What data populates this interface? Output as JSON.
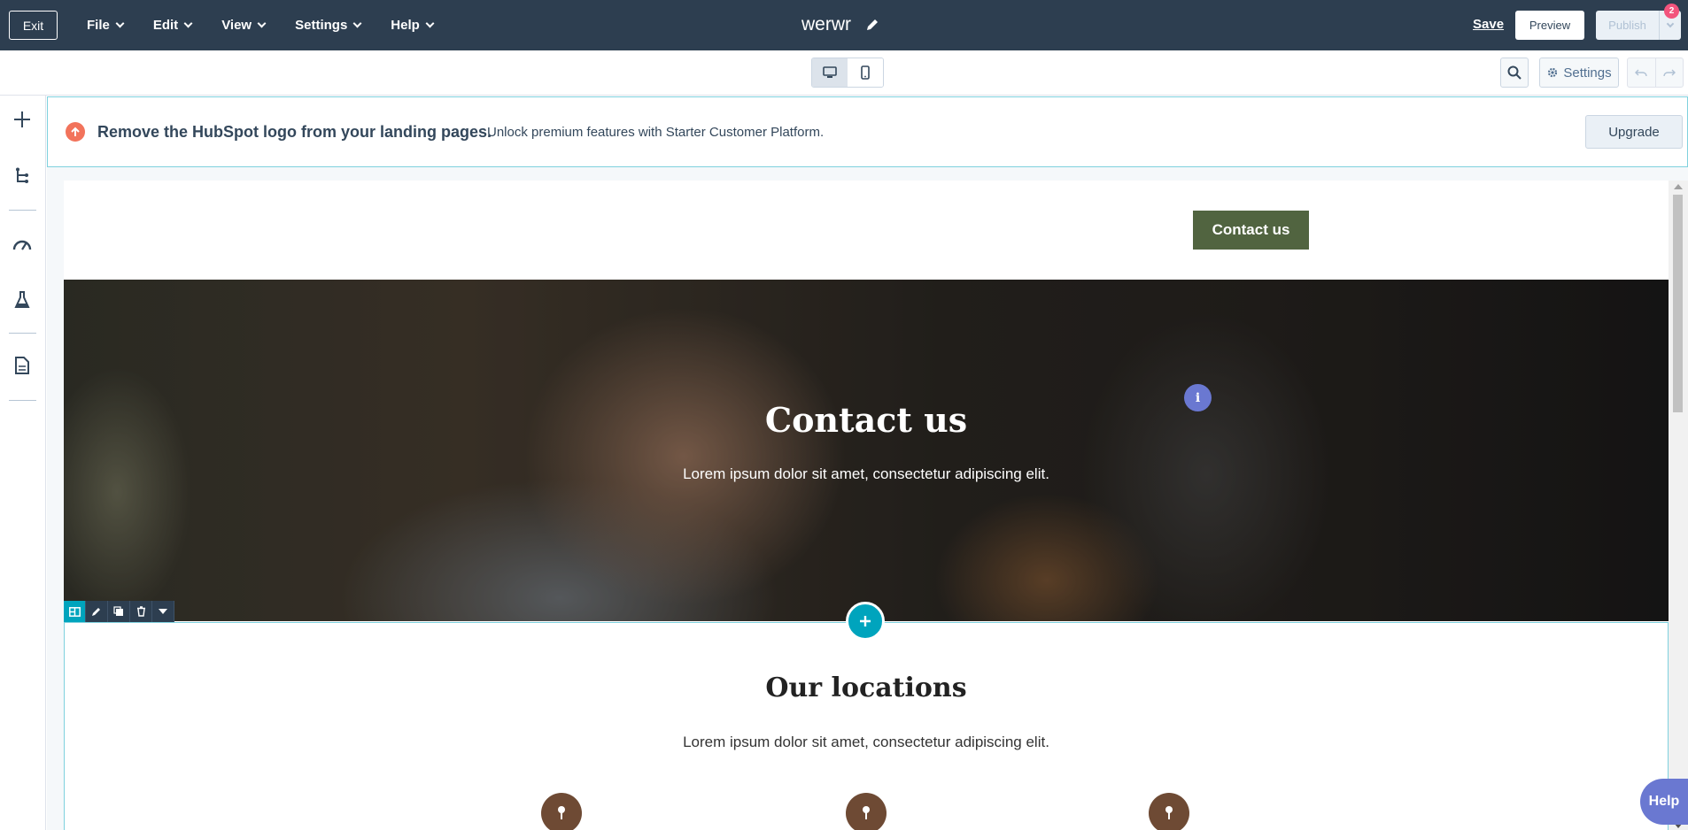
{
  "topbar": {
    "exit_label": "Exit",
    "menu": [
      "File",
      "Edit",
      "View",
      "Settings",
      "Help"
    ],
    "page_title": "werwr",
    "save_label": "Save",
    "preview_label": "Preview",
    "publish_label": "Publish",
    "notification_count": "2"
  },
  "toolbar": {
    "settings_label": "Settings"
  },
  "banner": {
    "title": "Remove the HubSpot logo from your landing pages.",
    "text": "Unlock premium features with Starter Customer Platform.",
    "upgrade_label": "Upgrade"
  },
  "page": {
    "header_button": "Contact us",
    "hero_title": "Contact us",
    "hero_subtitle": "Lorem ipsum dolor sit amet, consectetur adipiscing elit.",
    "info_label": "i",
    "section_title": "Our locations",
    "section_subtitle": "Lorem ipsum dolor sit amet, consectetur adipiscing elit."
  },
  "help_label": "Help",
  "colors": {
    "nav_bg": "#2d3e50",
    "accent_teal": "#00a4bd",
    "header_button": "#516440",
    "pin_brown": "#6e4a34",
    "help_purple": "#6a78d1"
  }
}
